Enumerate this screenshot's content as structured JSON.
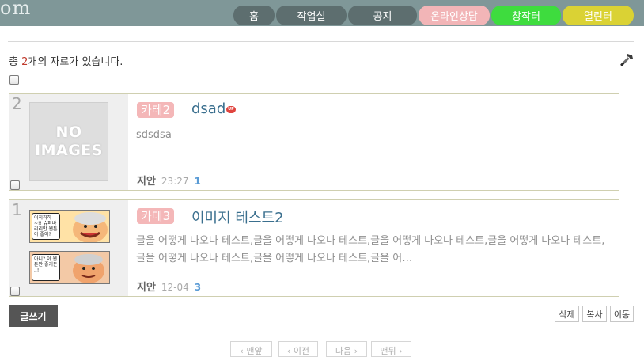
{
  "header": {
    "logo_text": "om",
    "nav": {
      "home": "홈",
      "workroom": "작업실",
      "notice": "공지",
      "consult": "온라인상담",
      "create": "창작터",
      "gallery": "열린터"
    }
  },
  "board": {
    "total_prefix": "총 ",
    "total_count": "2",
    "total_suffix": "개의 자료가 있습니다.",
    "posts": [
      {
        "number": "2",
        "thumbnail": {
          "type": "no-image",
          "line1": "NO",
          "line2": "IMAGES"
        },
        "category": "카테2",
        "title": "dsad",
        "new_badge": "UP",
        "excerpt": "sdsdsa",
        "author": "지안",
        "date": "23:27",
        "comments": "1"
      },
      {
        "number": "1",
        "thumbnail": {
          "type": "comic",
          "bubble1": "이히히히~!! 슈퍼바리리만 웹툰아 좋아?",
          "bubble2": "아니? 이 웹툰만 좋거든 ..!!"
        },
        "category": "카테3",
        "title": "이미지 테스트2",
        "excerpt": "글을 어떻게 나오나 테스트,글을 어떻게 나오나 테스트,글을 어떻게 나오나 테스트,글을 어떻게 나오나 테스트,글을 어떻게 나오나 테스트,글을 어떻게 나오나 테스트,글을 어…",
        "author": "지안",
        "date": "12-04",
        "comments": "3"
      }
    ]
  },
  "actions": {
    "write": "글쓰기",
    "delete": "삭제",
    "copy": "복사",
    "move": "이동"
  },
  "pagination": {
    "first": "‹ 맨앞",
    "prev": "‹ 이전",
    "next": "다음 ›",
    "last": "맨뒤 ›"
  },
  "icons": {
    "tools": "hammer-icon"
  },
  "colors": {
    "topbar": "#7f9798",
    "nav_default": "#5d6e6f",
    "nav_consult": "#f2b5b7",
    "nav_create": "#3edc3e",
    "nav_gallery": "#dad234",
    "category_badge": "#f4b7b8",
    "title_link": "#3a6f8e",
    "write_button": "#555555"
  }
}
